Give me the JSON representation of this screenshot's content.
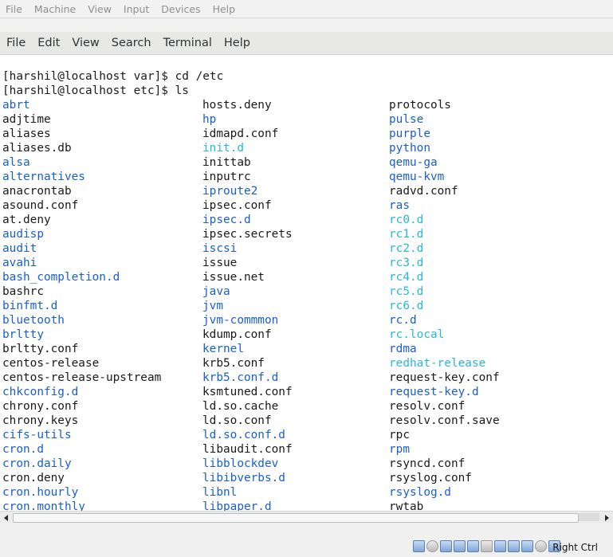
{
  "vbox_menu": [
    "File",
    "Machine",
    "View",
    "Input",
    "Devices",
    "Help"
  ],
  "terminal_menu": [
    "File",
    "Edit",
    "View",
    "Search",
    "Terminal",
    "Help"
  ],
  "commands": [
    "[harshil@localhost var]$ cd /etc",
    "[harshil@localhost etc]$ ls"
  ],
  "colors": {
    "directory": "#1a5fcc",
    "symlink": "#29b7dd",
    "file": "#1a1a1a"
  },
  "listing_columns": [
    [
      {
        "name": "abrt",
        "type": "dir"
      },
      {
        "name": "adjtime",
        "type": "file"
      },
      {
        "name": "aliases",
        "type": "file"
      },
      {
        "name": "aliases.db",
        "type": "file"
      },
      {
        "name": "alsa",
        "type": "dir"
      },
      {
        "name": "alternatives",
        "type": "dir"
      },
      {
        "name": "anacrontab",
        "type": "file"
      },
      {
        "name": "asound.conf",
        "type": "file"
      },
      {
        "name": "at.deny",
        "type": "file"
      },
      {
        "name": "audisp",
        "type": "dir"
      },
      {
        "name": "audit",
        "type": "dir"
      },
      {
        "name": "avahi",
        "type": "dir"
      },
      {
        "name": "bash_completion.d",
        "type": "dir"
      },
      {
        "name": "bashrc",
        "type": "file"
      },
      {
        "name": "binfmt.d",
        "type": "dir"
      },
      {
        "name": "bluetooth",
        "type": "dir"
      },
      {
        "name": "brltty",
        "type": "dir"
      },
      {
        "name": "brltty.conf",
        "type": "file"
      },
      {
        "name": "centos-release",
        "type": "file"
      },
      {
        "name": "centos-release-upstream",
        "type": "file"
      },
      {
        "name": "chkconfig.d",
        "type": "dir"
      },
      {
        "name": "chrony.conf",
        "type": "file"
      },
      {
        "name": "chrony.keys",
        "type": "file"
      },
      {
        "name": "cifs-utils",
        "type": "dir"
      },
      {
        "name": "cron.d",
        "type": "dir"
      },
      {
        "name": "cron.daily",
        "type": "dir"
      },
      {
        "name": "cron.deny",
        "type": "file"
      },
      {
        "name": "cron.hourly",
        "type": "dir"
      },
      {
        "name": "cron.monthly",
        "type": "dir"
      }
    ],
    [
      {
        "name": "hosts.deny",
        "type": "file"
      },
      {
        "name": "hp",
        "type": "dir"
      },
      {
        "name": "idmapd.conf",
        "type": "file"
      },
      {
        "name": "init.d",
        "type": "link"
      },
      {
        "name": "inittab",
        "type": "file"
      },
      {
        "name": "inputrc",
        "type": "file"
      },
      {
        "name": "iproute2",
        "type": "dir"
      },
      {
        "name": "ipsec.conf",
        "type": "file"
      },
      {
        "name": "ipsec.d",
        "type": "dir"
      },
      {
        "name": "ipsec.secrets",
        "type": "file"
      },
      {
        "name": "iscsi",
        "type": "dir"
      },
      {
        "name": "issue",
        "type": "file"
      },
      {
        "name": "issue.net",
        "type": "file"
      },
      {
        "name": "java",
        "type": "dir"
      },
      {
        "name": "jvm",
        "type": "dir"
      },
      {
        "name": "jvm-commmon",
        "type": "dir"
      },
      {
        "name": "kdump.conf",
        "type": "file"
      },
      {
        "name": "kernel",
        "type": "dir"
      },
      {
        "name": "krb5.conf",
        "type": "file"
      },
      {
        "name": "krb5.conf.d",
        "type": "dir"
      },
      {
        "name": "ksmtuned.conf",
        "type": "file"
      },
      {
        "name": "ld.so.cache",
        "type": "file"
      },
      {
        "name": "ld.so.conf",
        "type": "file"
      },
      {
        "name": "ld.so.conf.d",
        "type": "dir"
      },
      {
        "name": "libaudit.conf",
        "type": "file"
      },
      {
        "name": "libblockdev",
        "type": "dir"
      },
      {
        "name": "libibverbs.d",
        "type": "dir"
      },
      {
        "name": "libnl",
        "type": "dir"
      },
      {
        "name": "libpaper.d",
        "type": "dir"
      }
    ],
    [
      {
        "name": "protocols",
        "type": "file"
      },
      {
        "name": "pulse",
        "type": "dir"
      },
      {
        "name": "purple",
        "type": "dir"
      },
      {
        "name": "python",
        "type": "dir"
      },
      {
        "name": "qemu-ga",
        "type": "dir"
      },
      {
        "name": "qemu-kvm",
        "type": "dir"
      },
      {
        "name": "radvd.conf",
        "type": "file"
      },
      {
        "name": "ras",
        "type": "dir"
      },
      {
        "name": "rc0.d",
        "type": "link"
      },
      {
        "name": "rc1.d",
        "type": "link"
      },
      {
        "name": "rc2.d",
        "type": "link"
      },
      {
        "name": "rc3.d",
        "type": "link"
      },
      {
        "name": "rc4.d",
        "type": "link"
      },
      {
        "name": "rc5.d",
        "type": "link"
      },
      {
        "name": "rc6.d",
        "type": "link"
      },
      {
        "name": "rc.d",
        "type": "dir"
      },
      {
        "name": "rc.local",
        "type": "link"
      },
      {
        "name": "rdma",
        "type": "dir"
      },
      {
        "name": "redhat-release",
        "type": "link"
      },
      {
        "name": "request-key.conf",
        "type": "file"
      },
      {
        "name": "request-key.d",
        "type": "dir"
      },
      {
        "name": "resolv.conf",
        "type": "file"
      },
      {
        "name": "resolv.conf.save",
        "type": "file"
      },
      {
        "name": "rpc",
        "type": "file"
      },
      {
        "name": "rpm",
        "type": "dir"
      },
      {
        "name": "rsyncd.conf",
        "type": "file"
      },
      {
        "name": "rsyslog.conf",
        "type": "file"
      },
      {
        "name": "rsyslog.d",
        "type": "dir"
      },
      {
        "name": "rwtab",
        "type": "file"
      }
    ]
  ],
  "host_key_label": "Right Ctrl"
}
